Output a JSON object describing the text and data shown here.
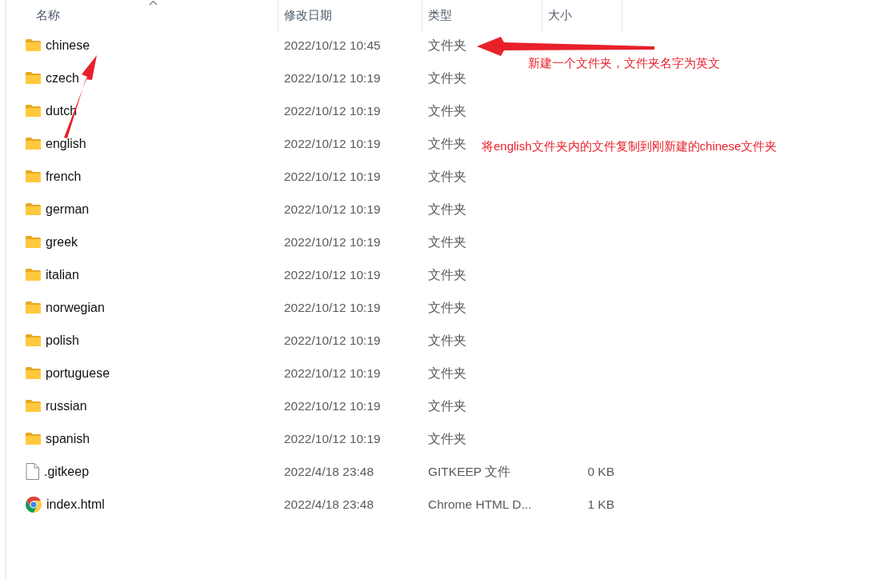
{
  "columns": [
    {
      "label": "名称",
      "sorted": true
    },
    {
      "label": "修改日期",
      "sorted": false
    },
    {
      "label": "类型",
      "sorted": false
    },
    {
      "label": "大小",
      "sorted": false
    }
  ],
  "rows": [
    {
      "kind": "folder",
      "name": "chinese",
      "date": "2022/10/12 10:45",
      "type": "文件夹"
    },
    {
      "kind": "folder",
      "name": "czech",
      "date": "2022/10/12 10:19",
      "type": "文件夹"
    },
    {
      "kind": "folder",
      "name": "dutch",
      "date": "2022/10/12 10:19",
      "type": "文件夹"
    },
    {
      "kind": "folder",
      "name": "english",
      "date": "2022/10/12 10:19",
      "type": "文件夹"
    },
    {
      "kind": "folder",
      "name": "french",
      "date": "2022/10/12 10:19",
      "type": "文件夹"
    },
    {
      "kind": "folder",
      "name": "german",
      "date": "2022/10/12 10:19",
      "type": "文件夹"
    },
    {
      "kind": "folder",
      "name": "greek",
      "date": "2022/10/12 10:19",
      "type": "文件夹"
    },
    {
      "kind": "folder",
      "name": "italian",
      "date": "2022/10/12 10:19",
      "type": "文件夹"
    },
    {
      "kind": "folder",
      "name": "norwegian",
      "date": "2022/10/12 10:19",
      "type": "文件夹"
    },
    {
      "kind": "folder",
      "name": "polish",
      "date": "2022/10/12 10:19",
      "type": "文件夹"
    },
    {
      "kind": "folder",
      "name": "portuguese",
      "date": "2022/10/12 10:19",
      "type": "文件夹"
    },
    {
      "kind": "folder",
      "name": "russian",
      "date": "2022/10/12 10:19",
      "type": "文件夹"
    },
    {
      "kind": "folder",
      "name": "spanish",
      "date": "2022/10/12 10:19",
      "type": "文件夹"
    },
    {
      "kind": "file",
      "name": ".gitkeep",
      "date": "2022/4/18 23:48",
      "type": "GITKEEP 文件",
      "size": "0 KB"
    },
    {
      "kind": "chrome",
      "name": "index.html",
      "date": "2022/4/18 23:48",
      "type": "Chrome HTML D...",
      "size": "1 KB"
    }
  ],
  "annotations": [
    {
      "text": "新建一个文件夹，文件夹名字为英文"
    },
    {
      "text": "将english文件夹内的文件复制到刚新建的chinese文件夹"
    }
  ]
}
